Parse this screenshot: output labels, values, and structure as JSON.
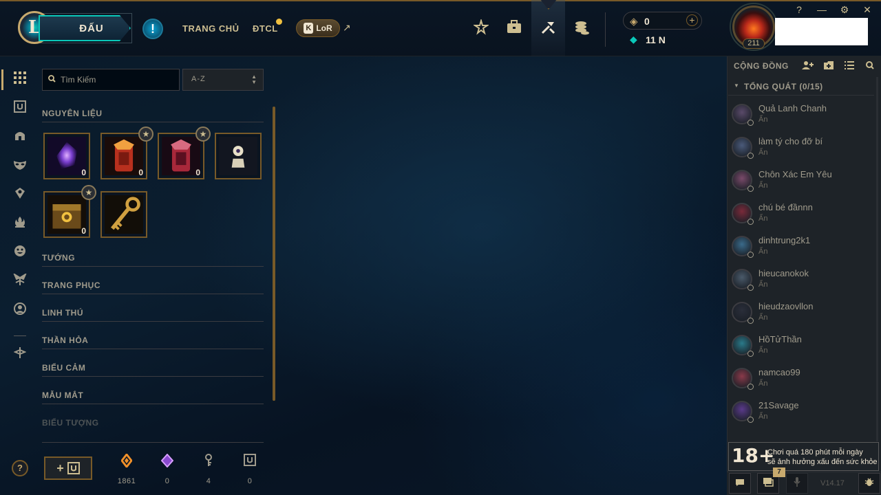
{
  "topbar": {
    "play_label": "ĐẤU",
    "alert_glyph": "!",
    "nav": [
      "TRANG CHỦ",
      "ĐTCL"
    ],
    "lor_label": "LoR",
    "lor_key": "K",
    "ext_arrow": "↗",
    "rp_value": "0",
    "be_value": "11 N",
    "level": "211",
    "window_controls": [
      "?",
      "—",
      "⚙",
      "✕"
    ],
    "icons": [
      "career-icon",
      "inventory-icon",
      "loot-icon",
      "store-icon"
    ]
  },
  "rail": {
    "icons": [
      "grid-icon",
      "chest-icon",
      "champion-helmet-icon",
      "mask-icon",
      "ward-icon",
      "fire-icon",
      "emote-icon",
      "eternals-icon",
      "profile-icon",
      "tft-icon"
    ]
  },
  "loot": {
    "search_placeholder": "Tìm Kiếm",
    "sort_value": "A-Z",
    "materials_title": "NGUYÊN LIỆU",
    "materials": [
      {
        "name": "orb-item",
        "count": "0",
        "starred": false,
        "color": "#6a3fd0"
      },
      {
        "name": "capsule-red-item",
        "count": "0",
        "starred": true,
        "color": "#c8402a"
      },
      {
        "name": "capsule-crimson-item",
        "count": "0",
        "starred": true,
        "color": "#b8283a"
      },
      {
        "name": "token-item",
        "count": "",
        "starred": false,
        "color": "#d8d0b8"
      },
      {
        "name": "hextech-chest-item",
        "count": "0",
        "starred": true,
        "color": "#8a6a2a"
      },
      {
        "name": "key-item",
        "count": "",
        "starred": false,
        "color": "#c8a040"
      }
    ],
    "categories": [
      "TƯỚNG",
      "TRANG PHỤC",
      "LINH THÚ",
      "THẦN HỎA",
      "BIỂU CẢM",
      "MẪU MẮT",
      "BIỂU TƯỢNG"
    ],
    "craft_label": "+",
    "resources": [
      {
        "name": "orange-essence",
        "value": "1861",
        "color": "#f0902a"
      },
      {
        "name": "mythic-essence",
        "value": "0",
        "color": "#b86ae0"
      },
      {
        "name": "key-fragment",
        "value": "4",
        "color": "#a09b8c"
      },
      {
        "name": "chest",
        "value": "0",
        "color": "#a09b8c"
      }
    ]
  },
  "social": {
    "title": "CỘNG ĐỒNG",
    "group_label": "TỔNG QUÁT (0/15)",
    "friends": [
      {
        "name": "Quả Lanh Chanh",
        "status": "Ẩn",
        "color": "#5a4a6a"
      },
      {
        "name": "làm tý cho đỡ bí",
        "status": "Ẩn",
        "color": "#4a5a7a"
      },
      {
        "name": "Chôn Xác Em Yêu",
        "status": "Ẩn",
        "color": "#7a4a6a"
      },
      {
        "name": "chú bé đầnnn",
        "status": "Ẩn",
        "color": "#7a2a3a"
      },
      {
        "name": "dinhtrung2k1",
        "status": "Ẩn",
        "color": "#3a6a8a"
      },
      {
        "name": "hieucanokok",
        "status": "Ẩn",
        "color": "#4a5a6a"
      },
      {
        "name": "hieudzaovllon",
        "status": "Ẩn",
        "color": "#2a2e3a"
      },
      {
        "name": "HồTửThần",
        "status": "Ẩn",
        "color": "#2a7a8a"
      },
      {
        "name": "namcao99",
        "status": "Ẩn",
        "color": "#8a3a4a"
      },
      {
        "name": "21Savage",
        "status": "Ẩn",
        "color": "#5a3a8a"
      }
    ],
    "age_rating": "18+",
    "age_text_1": "Chơi quá 180 phút mỗi ngày",
    "age_text_2": "sẽ ảnh hưởng xấu đến sức khỏe",
    "chat_badge": "7",
    "version": "V14.17"
  }
}
